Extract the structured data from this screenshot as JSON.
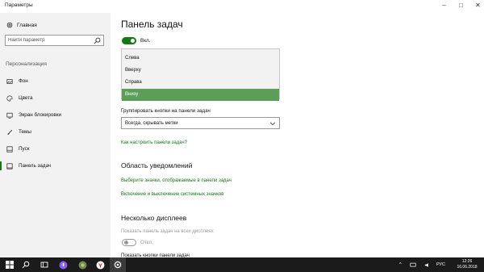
{
  "window": {
    "title": "Параметры",
    "controls": {
      "minimize": "–",
      "maximize": "□",
      "close": "✕"
    }
  },
  "sidebar": {
    "home_label": "Главная",
    "search_placeholder": "Найти параметр",
    "section_label": "Персонализация",
    "items": [
      {
        "label": "Фон",
        "icon": "picture-icon",
        "active": false
      },
      {
        "label": "Цвета",
        "icon": "palette-icon",
        "active": false
      },
      {
        "label": "Экран блокировки",
        "icon": "lock-screen-icon",
        "active": false
      },
      {
        "label": "Темы",
        "icon": "brush-icon",
        "active": false
      },
      {
        "label": "Пуск",
        "icon": "start-icon",
        "active": false
      },
      {
        "label": "Панель задач",
        "icon": "taskbar-icon",
        "active": true
      }
    ]
  },
  "main": {
    "title": "Панель задач",
    "lock_toggle": {
      "state": "on",
      "label": "Вкл."
    },
    "position_dropdown": {
      "options": [
        "Слева",
        "Вверху",
        "Справа",
        "Внизу"
      ],
      "selected": "Внизу"
    },
    "group_buttons": {
      "label": "Группировать кнопки на панели задач",
      "value": "Всегда, скрывать метки"
    },
    "customize_link": "Как настроить панели задач?",
    "notification_area": {
      "heading": "Область уведомлений",
      "links": [
        "Выберите значки, отображаемые в панели задач",
        "Включение и выключение системных значков"
      ]
    },
    "multiple_displays": {
      "heading": "Несколько дисплеев",
      "show_on_all_label": "Показать панель задач на всех дисплеях",
      "show_on_all_toggle": {
        "state": "off",
        "label": "Откл."
      },
      "show_buttons_label": "Показать кнопки панели задач"
    }
  },
  "taskbar": {
    "language": "РУС",
    "time": "12:26",
    "date": "16.06.2018"
  },
  "colors": {
    "accent": "#107c10",
    "selected_option": "#5a9e5a",
    "taskbar_bg": "#1b1b1b"
  }
}
